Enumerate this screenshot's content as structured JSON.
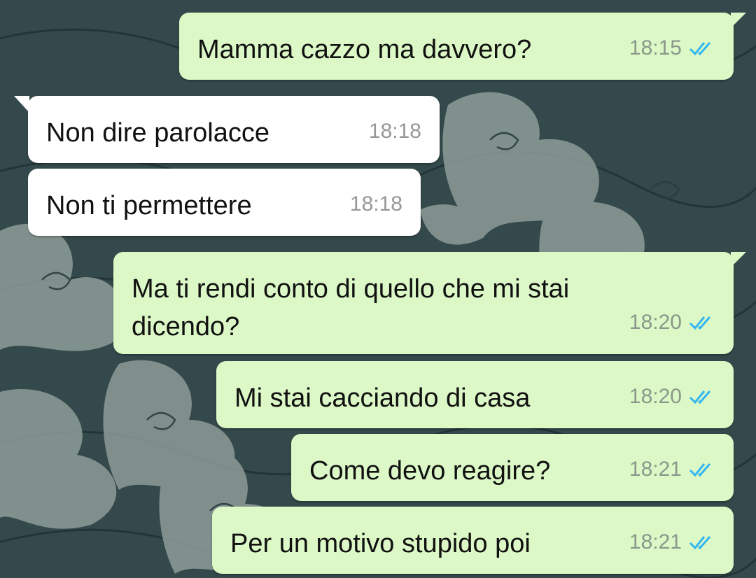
{
  "colors": {
    "outgoing_bubble": "#dcf8c6",
    "incoming_bubble": "#ffffff",
    "wallpaper_dark": "#2f4446",
    "wallpaper_light": "#8e9c98",
    "read_ticks": "#34b7f1"
  },
  "messages": [
    {
      "direction": "outgoing",
      "text": "Mamma cazzo ma davvero?",
      "time": "18:15",
      "status": "read",
      "status_icon": "double-check-icon"
    },
    {
      "direction": "incoming",
      "text": "Non dire parolacce",
      "time": "18:18"
    },
    {
      "direction": "incoming",
      "text": "Non ti permettere",
      "time": "18:18"
    },
    {
      "direction": "outgoing",
      "text": "Ma ti rendi conto di quello che mi stai dicendo?",
      "time": "18:20",
      "status": "read",
      "status_icon": "double-check-icon"
    },
    {
      "direction": "outgoing",
      "text": "Mi stai cacciando di casa",
      "time": "18:20",
      "status": "read",
      "status_icon": "double-check-icon"
    },
    {
      "direction": "outgoing",
      "text": "Come devo reagire?",
      "time": "18:21",
      "status": "read",
      "status_icon": "double-check-icon"
    },
    {
      "direction": "outgoing",
      "text": "Per un motivo stupido poi",
      "time": "18:21",
      "status": "read",
      "status_icon": "double-check-icon"
    }
  ]
}
